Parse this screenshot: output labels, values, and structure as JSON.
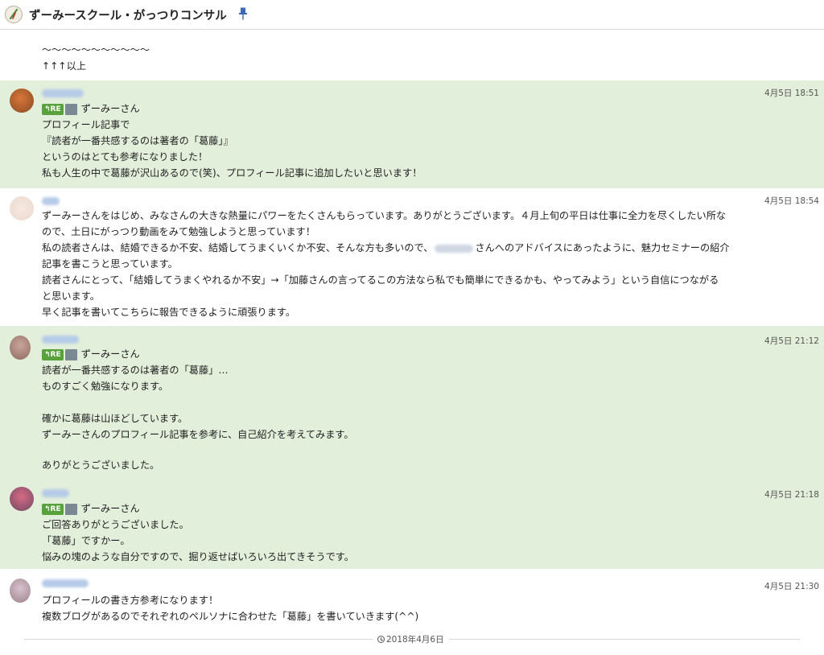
{
  "header": {
    "title": "ずーみースクール・がっつりコンサル"
  },
  "icons": {
    "room": "room-avatar-icon",
    "pin": "pin-icon",
    "reply": "reply-badge-icon",
    "clock": "clock-icon"
  },
  "colors": {
    "message_highlight_bg": "#e2efdb",
    "reply_badge": "#57a23d",
    "sender_name": "#b6cbe8"
  },
  "messages": [
    {
      "lines": [
        "〜〜〜〜〜〜〜〜〜〜〜",
        "↑↑↑以上"
      ]
    },
    {
      "time": "4月5日 18:51",
      "re_label": "RE",
      "reply_to": "ずーみーさん",
      "lines": [
        "プロフィール記事で",
        "『読者が一番共感するのは著者の「葛藤」』",
        "というのはとても参考になりました！",
        "私も人生の中で葛藤が沢山あるので(笑)、プロフィール記事に追加したいと思います！"
      ]
    },
    {
      "time": "4月5日 18:54",
      "lines": [
        "ずーみーさんをはじめ、みなさんの大きな熱量にパワーをたくさんもらっています。ありがとうございます。４月上旬の平日は仕事に全力を尽くしたい所な",
        "ので、土日にがっつり動画をみて勉強しようと思っています！",
        "私の読者さんは、結婚できるか不安、結婚してうまくいくか不安、そんな方も多いので、",
        "さんへのアドバイスにあったように、魅力セミナーの紹介",
        "記事を書こうと思っています。",
        "読者さんにとって、「結婚してうまくやれるか不安」→「加藤さんの言ってるこの方法なら私でも簡単にできるかも、やってみよう」という自信につながる",
        "と思います。",
        "早く記事を書いてこちらに報告できるように頑張ります。"
      ]
    },
    {
      "time": "4月5日 21:12",
      "re_label": "RE",
      "reply_to": "ずーみーさん",
      "lines": [
        "読者が一番共感するのは著者の「葛藤」…",
        "ものすごく勉強になります。",
        "",
        "確かに葛藤は山ほどしています。",
        "ずーみーさんのプロフィール記事を参考に、自己紹介を考えてみます。",
        "",
        "ありがとうございました。"
      ]
    },
    {
      "time": "4月5日 21:18",
      "re_label": "RE",
      "reply_to": "ずーみーさん",
      "lines": [
        "ご回答ありがとうございました。",
        "「葛藤」ですかー。",
        "悩みの塊のような自分ですので、掘り返せばいろいろ出てきそうです。"
      ]
    },
    {
      "time": "4月5日 21:30",
      "lines": [
        "プロフィールの書き方参考になります！",
        "複数ブログがあるのでそれぞれのペルソナに合わせた「葛藤」を書いていきます(^^)"
      ]
    }
  ],
  "date_divider": {
    "label": "2018年4月6日"
  }
}
